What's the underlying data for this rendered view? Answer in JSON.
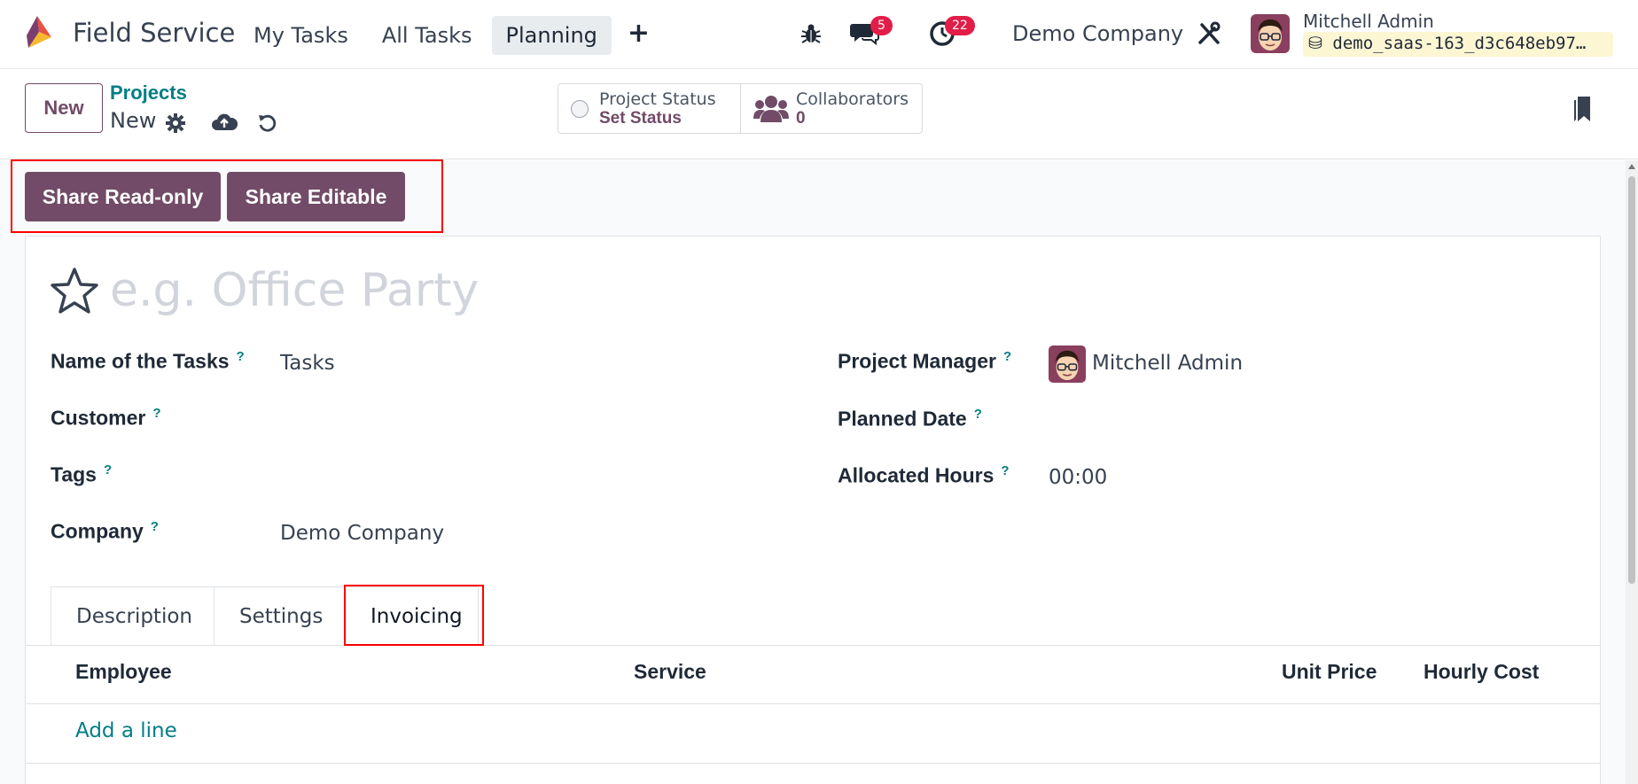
{
  "navbar": {
    "app_name": "Field Service",
    "menu": [
      {
        "label": "My Tasks",
        "active": false
      },
      {
        "label": "All Tasks",
        "active": false
      },
      {
        "label": "Planning",
        "active": true
      }
    ],
    "plus_label": "+",
    "messages_count": "5",
    "activities_count": "22",
    "company": "Demo Company",
    "user_name": "Mitchell Admin",
    "database": "demo_saas-163_d3c648eb97…"
  },
  "control_panel": {
    "new_label": "New",
    "breadcrumb_parent": "Projects",
    "breadcrumb_current": "New",
    "project_status_label": "Project Status",
    "project_status_value": "Set Status",
    "collaborators_label": "Collaborators",
    "collaborators_value": "0"
  },
  "actions": {
    "share_readonly": "Share Read-only",
    "share_editable": "Share Editable"
  },
  "form": {
    "title_placeholder": "e.g. Office Party",
    "fields_left": [
      {
        "label": "Name of the Tasks",
        "help": "?",
        "value": "Tasks"
      },
      {
        "label": "Customer",
        "help": "?",
        "value": ""
      },
      {
        "label": "Tags",
        "help": "?",
        "value": ""
      },
      {
        "label": "Company",
        "help": "?",
        "value": "Demo Company"
      }
    ],
    "fields_right": [
      {
        "label": "Project Manager",
        "help": "?",
        "value": "Mitchell Admin"
      },
      {
        "label": "Planned Date",
        "help": "?",
        "value": ""
      },
      {
        "label": "Allocated Hours",
        "help": "?",
        "value": "00:00"
      }
    ]
  },
  "tabs": [
    {
      "label": "Description",
      "active": false
    },
    {
      "label": "Settings",
      "active": false
    },
    {
      "label": "Invoicing",
      "active": true
    }
  ],
  "invoicing_table": {
    "columns": [
      "Employee",
      "Service",
      "Unit Price",
      "Hourly Cost"
    ],
    "add_line": "Add a line"
  },
  "colors": {
    "brand": "#714b67",
    "link": "#017e84",
    "highlight": "#ff0000",
    "badge": "#e11d48"
  }
}
